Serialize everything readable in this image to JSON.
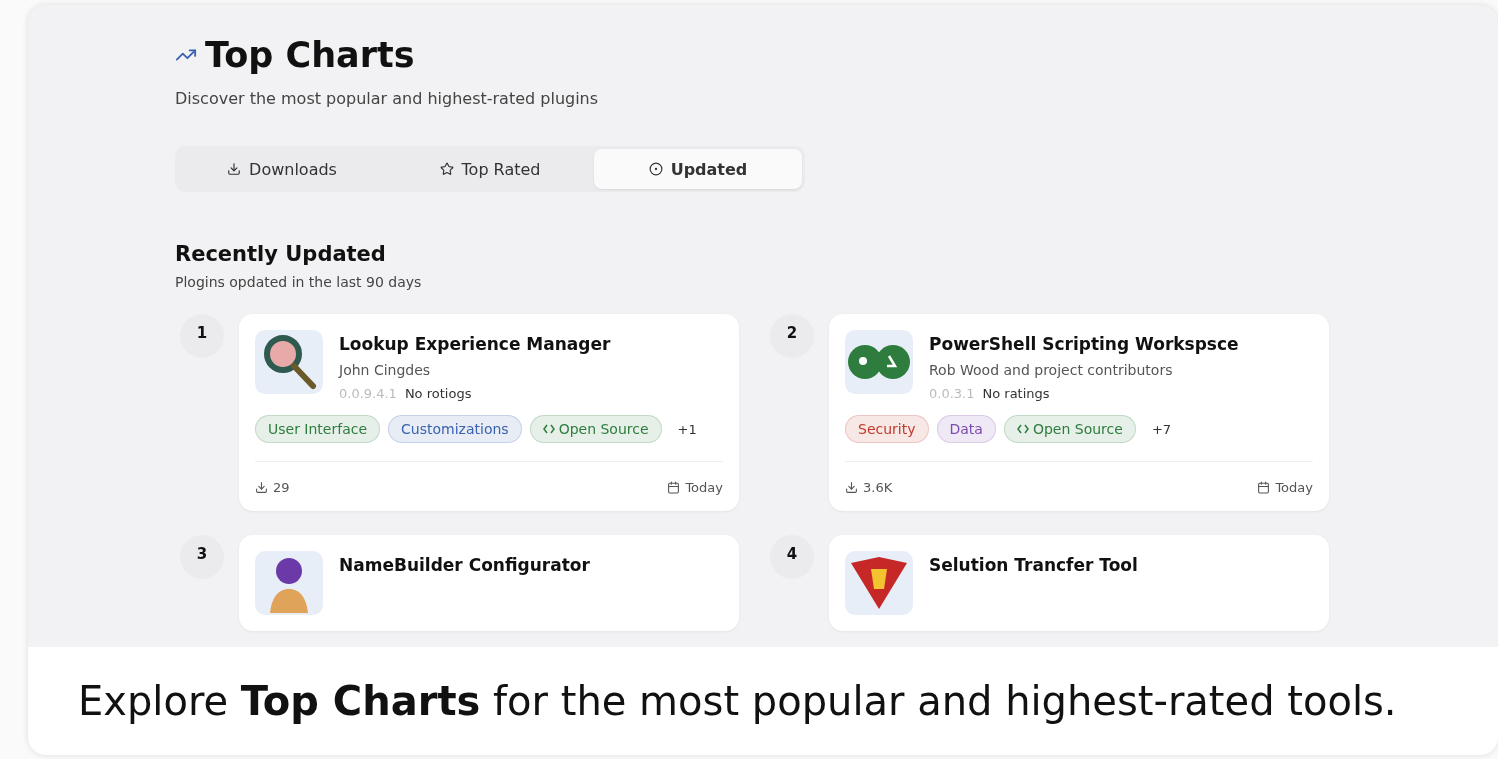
{
  "header": {
    "title": "Top Charts",
    "subtitle": "Discover the most popular and highest-rated plugins"
  },
  "tabs": [
    {
      "label": "Downloads",
      "selected": false
    },
    {
      "label": "Top Rated",
      "selected": false
    },
    {
      "label": "Updated",
      "selected": true
    }
  ],
  "section": {
    "title": "Recently Updated",
    "subtitle": "Plogins opdated in the last 90 days"
  },
  "plugins": [
    {
      "rank": "1",
      "name": "Lookup Experience Manager",
      "author": "John Cingdes",
      "version": "0.0.9.4.1",
      "rating": "No rotiogs",
      "tags": [
        {
          "label": "User Interface",
          "color": "#2e7d3e",
          "kind": "plain"
        },
        {
          "label": "Customizations",
          "color": "#3a62b0",
          "kind": "plain"
        },
        {
          "label": "Open Source",
          "color": "#2e7d3e",
          "kind": "code"
        }
      ],
      "more": "+1",
      "downloads": "29",
      "updated": "Today"
    },
    {
      "rank": "2",
      "name": "PowerShell Scripting Workspsce",
      "author": "Rob Wood and project contributors",
      "version": "0.0.3.1",
      "rating": "No ratings",
      "tags": [
        {
          "label": "Security",
          "color": "#c0392b",
          "kind": "plain"
        },
        {
          "label": "Data",
          "color": "#7b4bb0",
          "kind": "plain"
        },
        {
          "label": "Open Source",
          "color": "#2e7d3e",
          "kind": "code"
        }
      ],
      "more": "+7",
      "downloads": "3.6K",
      "updated": "Today"
    },
    {
      "rank": "3",
      "name": "NameBuilder Configurator"
    },
    {
      "rank": "4",
      "name": "Selution Trancfer Tool"
    }
  ],
  "caption": "Explore **Top Charts** for the most popular and highest-rated tools."
}
